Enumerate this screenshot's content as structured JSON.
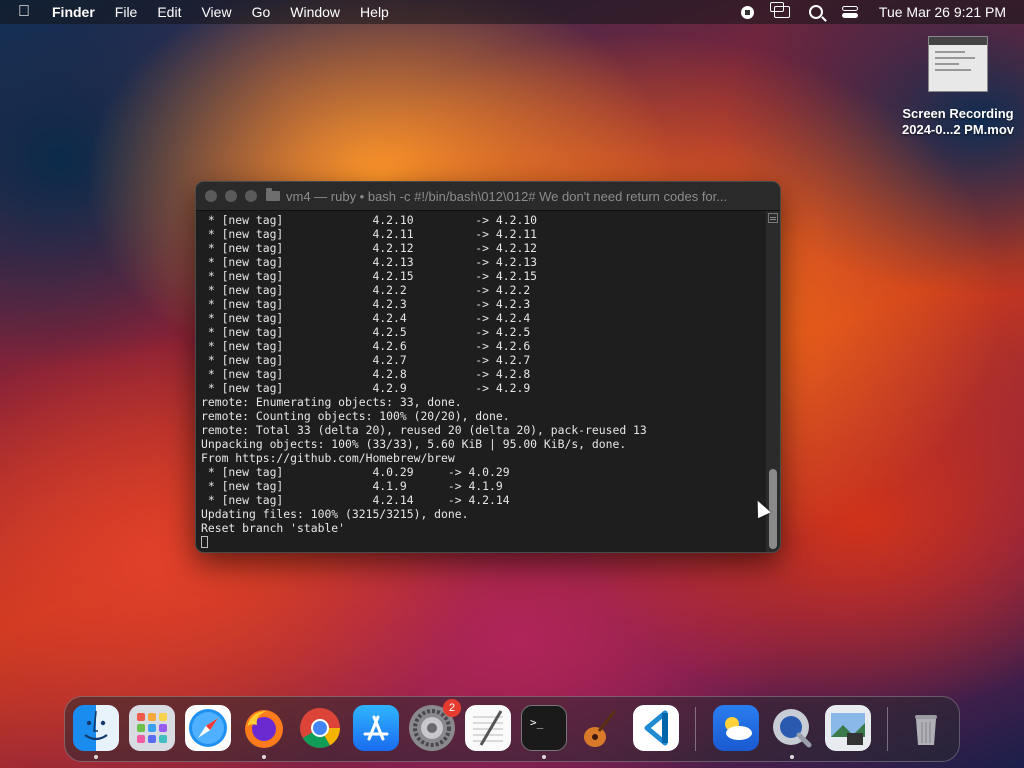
{
  "menubar": {
    "app": "Finder",
    "menus": [
      "File",
      "Edit",
      "View",
      "Go",
      "Window",
      "Help"
    ],
    "clock": "Tue Mar 26  9:21 PM"
  },
  "desktop_file": {
    "name_line1": "Screen Recording",
    "name_line2": "2024-0...2 PM.mov"
  },
  "terminal": {
    "title": "vm4 — ruby • bash -c #!/bin/bash\\012\\012# We don't need return codes for...",
    "lines": [
      " * [new tag]             4.2.10         -> 4.2.10",
      " * [new tag]             4.2.11         -> 4.2.11",
      " * [new tag]             4.2.12         -> 4.2.12",
      " * [new tag]             4.2.13         -> 4.2.13",
      " * [new tag]             4.2.15         -> 4.2.15",
      " * [new tag]             4.2.2          -> 4.2.2",
      " * [new tag]             4.2.3          -> 4.2.3",
      " * [new tag]             4.2.4          -> 4.2.4",
      " * [new tag]             4.2.5          -> 4.2.5",
      " * [new tag]             4.2.6          -> 4.2.6",
      " * [new tag]             4.2.7          -> 4.2.7",
      " * [new tag]             4.2.8          -> 4.2.8",
      " * [new tag]             4.2.9          -> 4.2.9",
      "remote: Enumerating objects: 33, done.",
      "remote: Counting objects: 100% (20/20), done.",
      "remote: Total 33 (delta 20), reused 20 (delta 20), pack-reused 13",
      "Unpacking objects: 100% (33/33), 5.60 KiB | 95.00 KiB/s, done.",
      "From https://github.com/Homebrew/brew",
      " * [new tag]             4.0.29     -> 4.0.29",
      " * [new tag]             4.1.9      -> 4.1.9",
      " * [new tag]             4.2.14     -> 4.2.14",
      "Updating files: 100% (3215/3215), done.",
      "Reset branch 'stable'"
    ]
  },
  "dock": {
    "apps": [
      {
        "name": "Finder",
        "icon": "finder-icon",
        "running": true
      },
      {
        "name": "Launchpad",
        "icon": "launchpad-icon",
        "running": false
      },
      {
        "name": "Safari",
        "icon": "safari-icon",
        "running": false
      },
      {
        "name": "Firefox",
        "icon": "firefox-icon",
        "running": true
      },
      {
        "name": "Chrome",
        "icon": "chrome-icon",
        "running": false
      },
      {
        "name": "App Store",
        "icon": "app-store-icon",
        "running": false
      },
      {
        "name": "System Settings",
        "icon": "system-settings-icon",
        "running": false,
        "badge": "2"
      },
      {
        "name": "TextEdit",
        "icon": "textedit-icon",
        "running": false
      },
      {
        "name": "Terminal",
        "icon": "terminal-icon",
        "running": true
      },
      {
        "name": "Instruments",
        "icon": "guitar-icon",
        "running": false
      },
      {
        "name": "Visual Studio Code",
        "icon": "vscode-icon",
        "running": false
      },
      {
        "name": "Weather",
        "icon": "weather-icon",
        "running": false
      },
      {
        "name": "QuickTime Player",
        "icon": "quicktime-icon",
        "running": true
      },
      {
        "name": "Preview",
        "icon": "preview-icon",
        "running": false
      },
      {
        "name": "Trash",
        "icon": "trash-icon",
        "running": false
      }
    ]
  }
}
